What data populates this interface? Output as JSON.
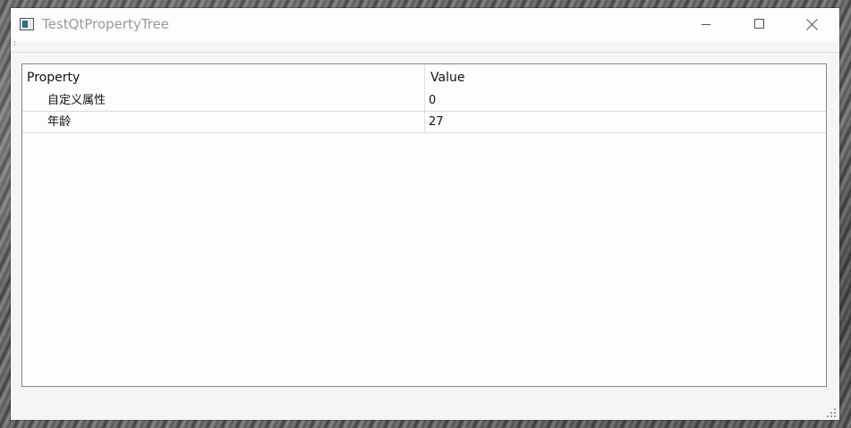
{
  "window": {
    "title": "TestQtPropertyTree",
    "menu_indicator": ":"
  },
  "icons": {
    "app": "app-window-icon",
    "minimize": "minimize-icon",
    "maximize": "maximize-icon",
    "close": "close-icon",
    "resize_grip": "resize-grip-icon"
  },
  "property_tree": {
    "columns": [
      "Property",
      "Value"
    ],
    "rows": [
      {
        "name": "自定义属性",
        "value": "0"
      },
      {
        "name": "年龄",
        "value": "27"
      }
    ]
  },
  "colors": {
    "title_text": "#9a9a9a",
    "app_icon_accent": "#2f6f7a",
    "tree_border": "#828790"
  }
}
